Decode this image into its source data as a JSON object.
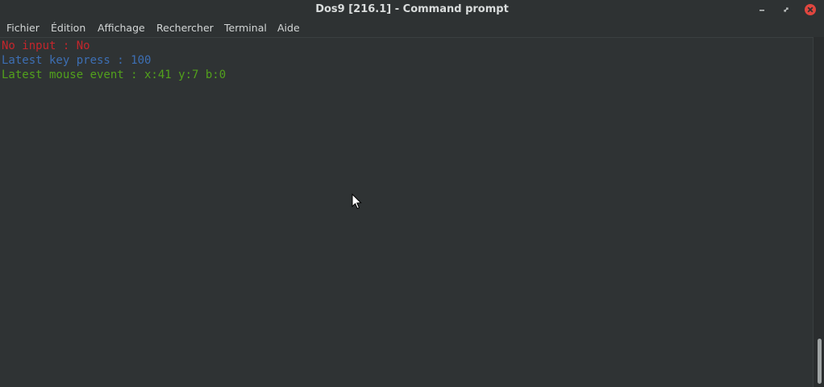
{
  "window": {
    "title": "Dos9 [216.1] - Command prompt",
    "titlebar_color": "#2e3233",
    "close_color": "#e0463f"
  },
  "menubar": {
    "items": [
      {
        "label": "Fichier"
      },
      {
        "label": "Édition"
      },
      {
        "label": "Affichage"
      },
      {
        "label": "Rechercher"
      },
      {
        "label": "Terminal"
      },
      {
        "label": "Aide"
      }
    ]
  },
  "terminal": {
    "background": "#2f3334",
    "lines": [
      {
        "text": "No input : No",
        "color": "#c4262c"
      },
      {
        "text": "Latest key press : 100",
        "color": "#3d6fb4"
      },
      {
        "text": "Latest mouse event : x:41 y:7 b:0",
        "color": "#52a11c"
      }
    ]
  },
  "icons": {
    "minimize": "minimize-icon",
    "maximize": "maximize-icon",
    "close": "close-icon",
    "pointer": "mouse-pointer-icon"
  }
}
